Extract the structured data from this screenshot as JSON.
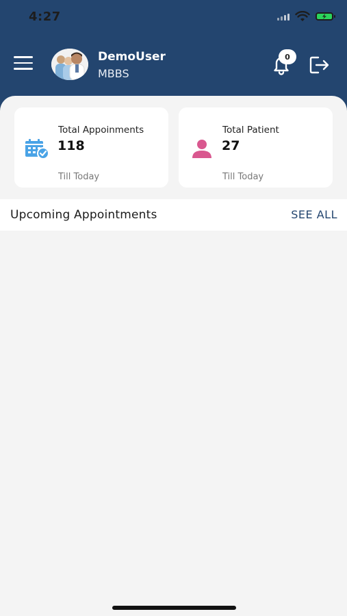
{
  "status_bar": {
    "time": "4:27",
    "icons": [
      "signal-icon",
      "wifi-icon",
      "battery-charging-icon"
    ]
  },
  "header": {
    "user_name": "DemoUser",
    "user_degree": "MBBS",
    "notification_count": "0",
    "icons": [
      "menu-icon",
      "bell-icon",
      "logout-icon"
    ]
  },
  "cards": [
    {
      "title": "Total Appoinments",
      "value": "118",
      "subtitle": "Till Today",
      "icon": "calendar-check-icon",
      "icon_color": "#4aa3e6"
    },
    {
      "title": "Total Patient",
      "value": "27",
      "subtitle": "Till Today",
      "icon": "person-icon",
      "icon_color": "#d9588f"
    }
  ],
  "upcoming": {
    "title": "Upcoming Appointments",
    "see_all_label": "SEE ALL"
  },
  "colors": {
    "header_bg": "#23456f",
    "page_bg": "#f4f4f4",
    "accent": "#23456f"
  }
}
